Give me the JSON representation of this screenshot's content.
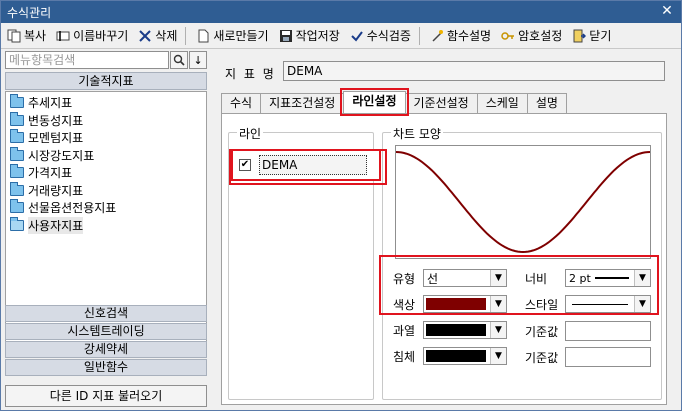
{
  "window": {
    "title": "수식관리",
    "close_glyph": "✕"
  },
  "toolbar": {
    "copy": "복사",
    "rename": "이름바꾸기",
    "delete": "삭제",
    "new": "새로만들기",
    "save": "작업저장",
    "verify": "수식검증",
    "func_help": "함수설명",
    "password": "암호설정",
    "close": "닫기"
  },
  "sidebar": {
    "search_placeholder": "메뉴항목검색",
    "search_icon": "🔍",
    "down_glyph": "↓",
    "category_header": "기술적지표",
    "items": [
      {
        "label": "추세지표"
      },
      {
        "label": "변동성지표"
      },
      {
        "label": "모멘텀지표"
      },
      {
        "label": "시장강도지표"
      },
      {
        "label": "가격지표"
      },
      {
        "label": "거래량지표"
      },
      {
        "label": "선물옵션전용지표"
      },
      {
        "label": "사용자지표"
      }
    ],
    "bottom_tabs": [
      {
        "label": "신호검색"
      },
      {
        "label": "시스템트레이딩"
      },
      {
        "label": "강세약세"
      },
      {
        "label": "일반함수"
      }
    ],
    "load_button": "다른 ID 지표 불러오기"
  },
  "main": {
    "name_label": "지 표 명",
    "name_value": "DEMA",
    "tabs": [
      {
        "label": "수식"
      },
      {
        "label": "지표조건설정"
      },
      {
        "label": "라인설정",
        "active": true
      },
      {
        "label": "기준선설정"
      },
      {
        "label": "스케일"
      },
      {
        "label": "설명"
      }
    ],
    "line_group": {
      "title": "라인",
      "check_glyph": "✔",
      "line_name": "DEMA"
    },
    "chart_group": {
      "title": "차트 모양",
      "type_label": "유형",
      "type_value": "선",
      "width_label": "너비",
      "width_value": "2 pt",
      "color_label": "색상",
      "color_value": "#7f0000",
      "style_label": "스타일",
      "over_label": "과열",
      "over_color": "#000000",
      "over_base_label": "기준값",
      "under_label": "침체",
      "under_color": "#000000",
      "under_base_label": "기준값"
    }
  },
  "colors": {
    "titlebar": "#2f5d93",
    "highlight": "#e0141e",
    "line_color": "#7f0000"
  }
}
